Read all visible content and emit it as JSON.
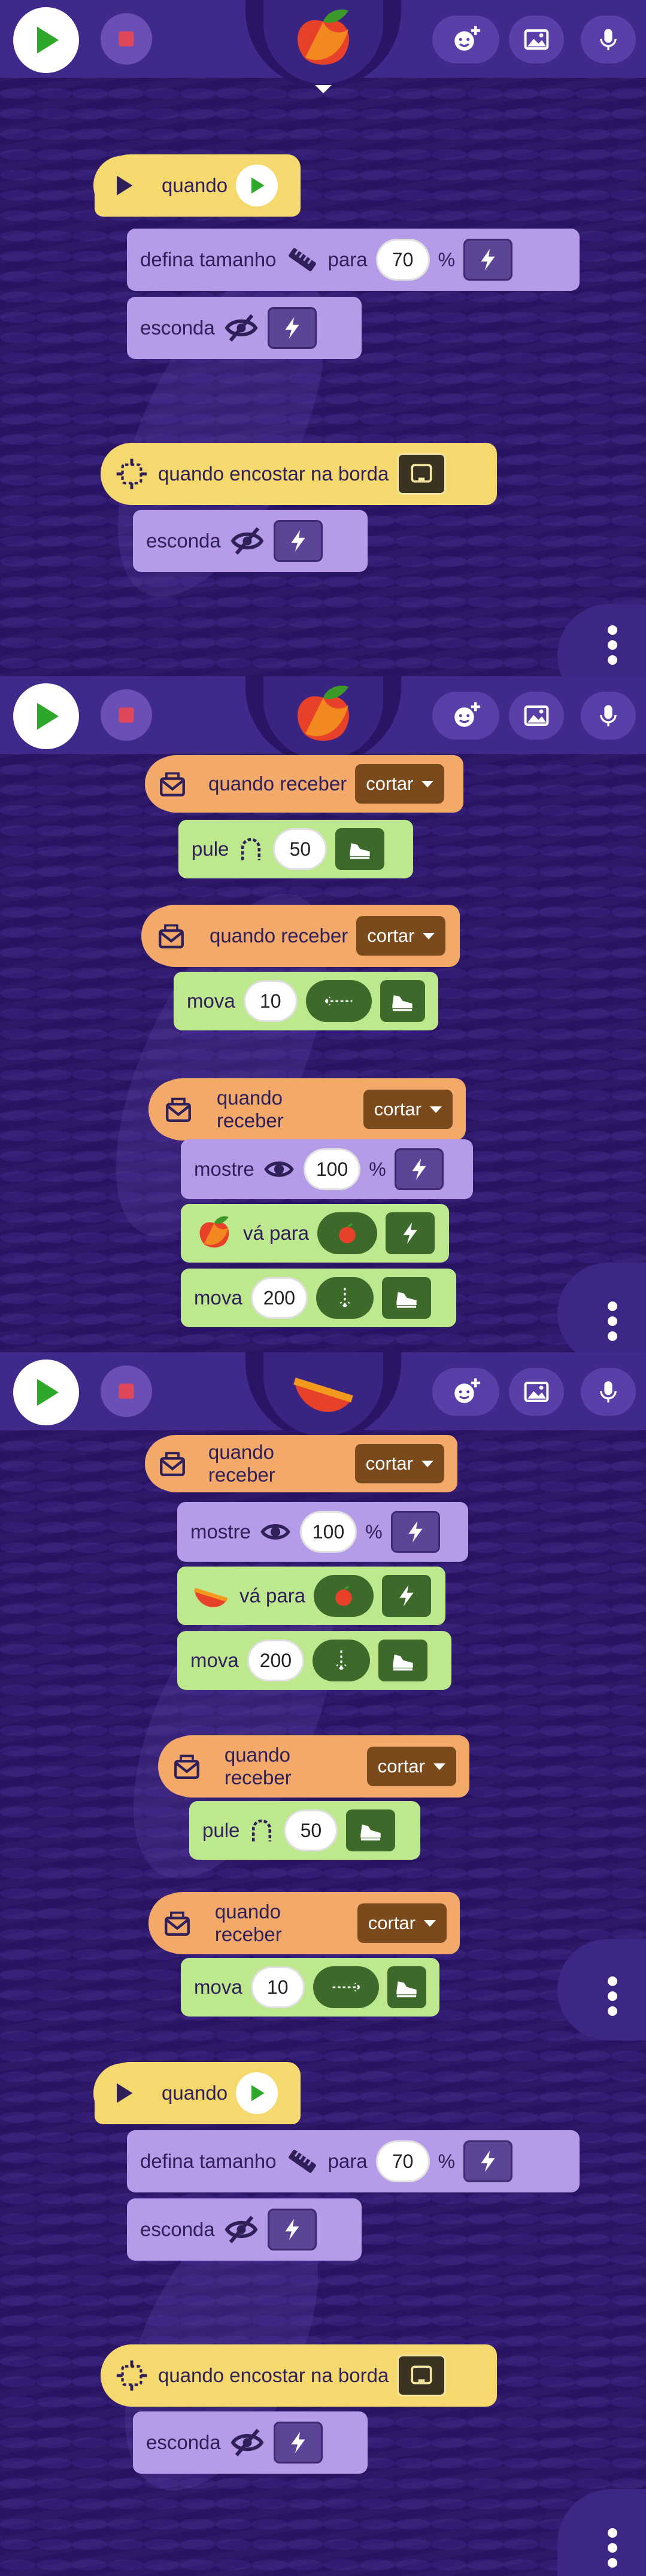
{
  "toolbar": {
    "play_icon": "play-icon",
    "stop_icon": "stop-icon",
    "add_sprite_icon": "add-character-icon",
    "image_icon": "image-icon",
    "mic_icon": "microphone-icon",
    "menu_icon": "more-vertical-icon"
  },
  "screen1": {
    "script1": {
      "hat_label": "quando",
      "set_size_label": "defina tamanho",
      "to_label": "para",
      "size_value": "70",
      "percent": "%",
      "hide_label": "esconda"
    },
    "script2": {
      "hat_label": "quando encostar na borda",
      "hide_label": "esconda"
    }
  },
  "screen2": {
    "script1": {
      "receive_label": "quando receber",
      "message": "cortar",
      "jump_label": "pule",
      "jump_value": "50"
    },
    "script2": {
      "receive_label": "quando receber",
      "message": "cortar",
      "move_label": "mova",
      "move_value": "10"
    },
    "script3": {
      "receive_label": "quando receber",
      "message": "cortar",
      "show_label": "mostre",
      "show_value": "100",
      "percent": "%",
      "goto_label": "vá para",
      "move_label": "mova",
      "move_value": "200"
    }
  },
  "screen3": {
    "script1": {
      "receive_label": "quando receber",
      "message": "cortar",
      "show_label": "mostre",
      "show_value": "100",
      "percent": "%",
      "goto_label": "vá para",
      "move_label": "mova",
      "move_value": "200"
    },
    "script2": {
      "receive_label": "quando receber",
      "message": "cortar",
      "jump_label": "pule",
      "jump_value": "50"
    },
    "script3": {
      "receive_label": "quando receber",
      "message": "cortar",
      "move_label": "mova",
      "move_value": "10"
    },
    "script4": {
      "hat_label": "quando",
      "set_size_label": "defina tamanho",
      "to_label": "para",
      "size_value": "70",
      "percent": "%",
      "hide_label": "esconda"
    },
    "script5": {
      "hat_label": "quando encostar na borda",
      "hide_label": "esconda"
    }
  }
}
